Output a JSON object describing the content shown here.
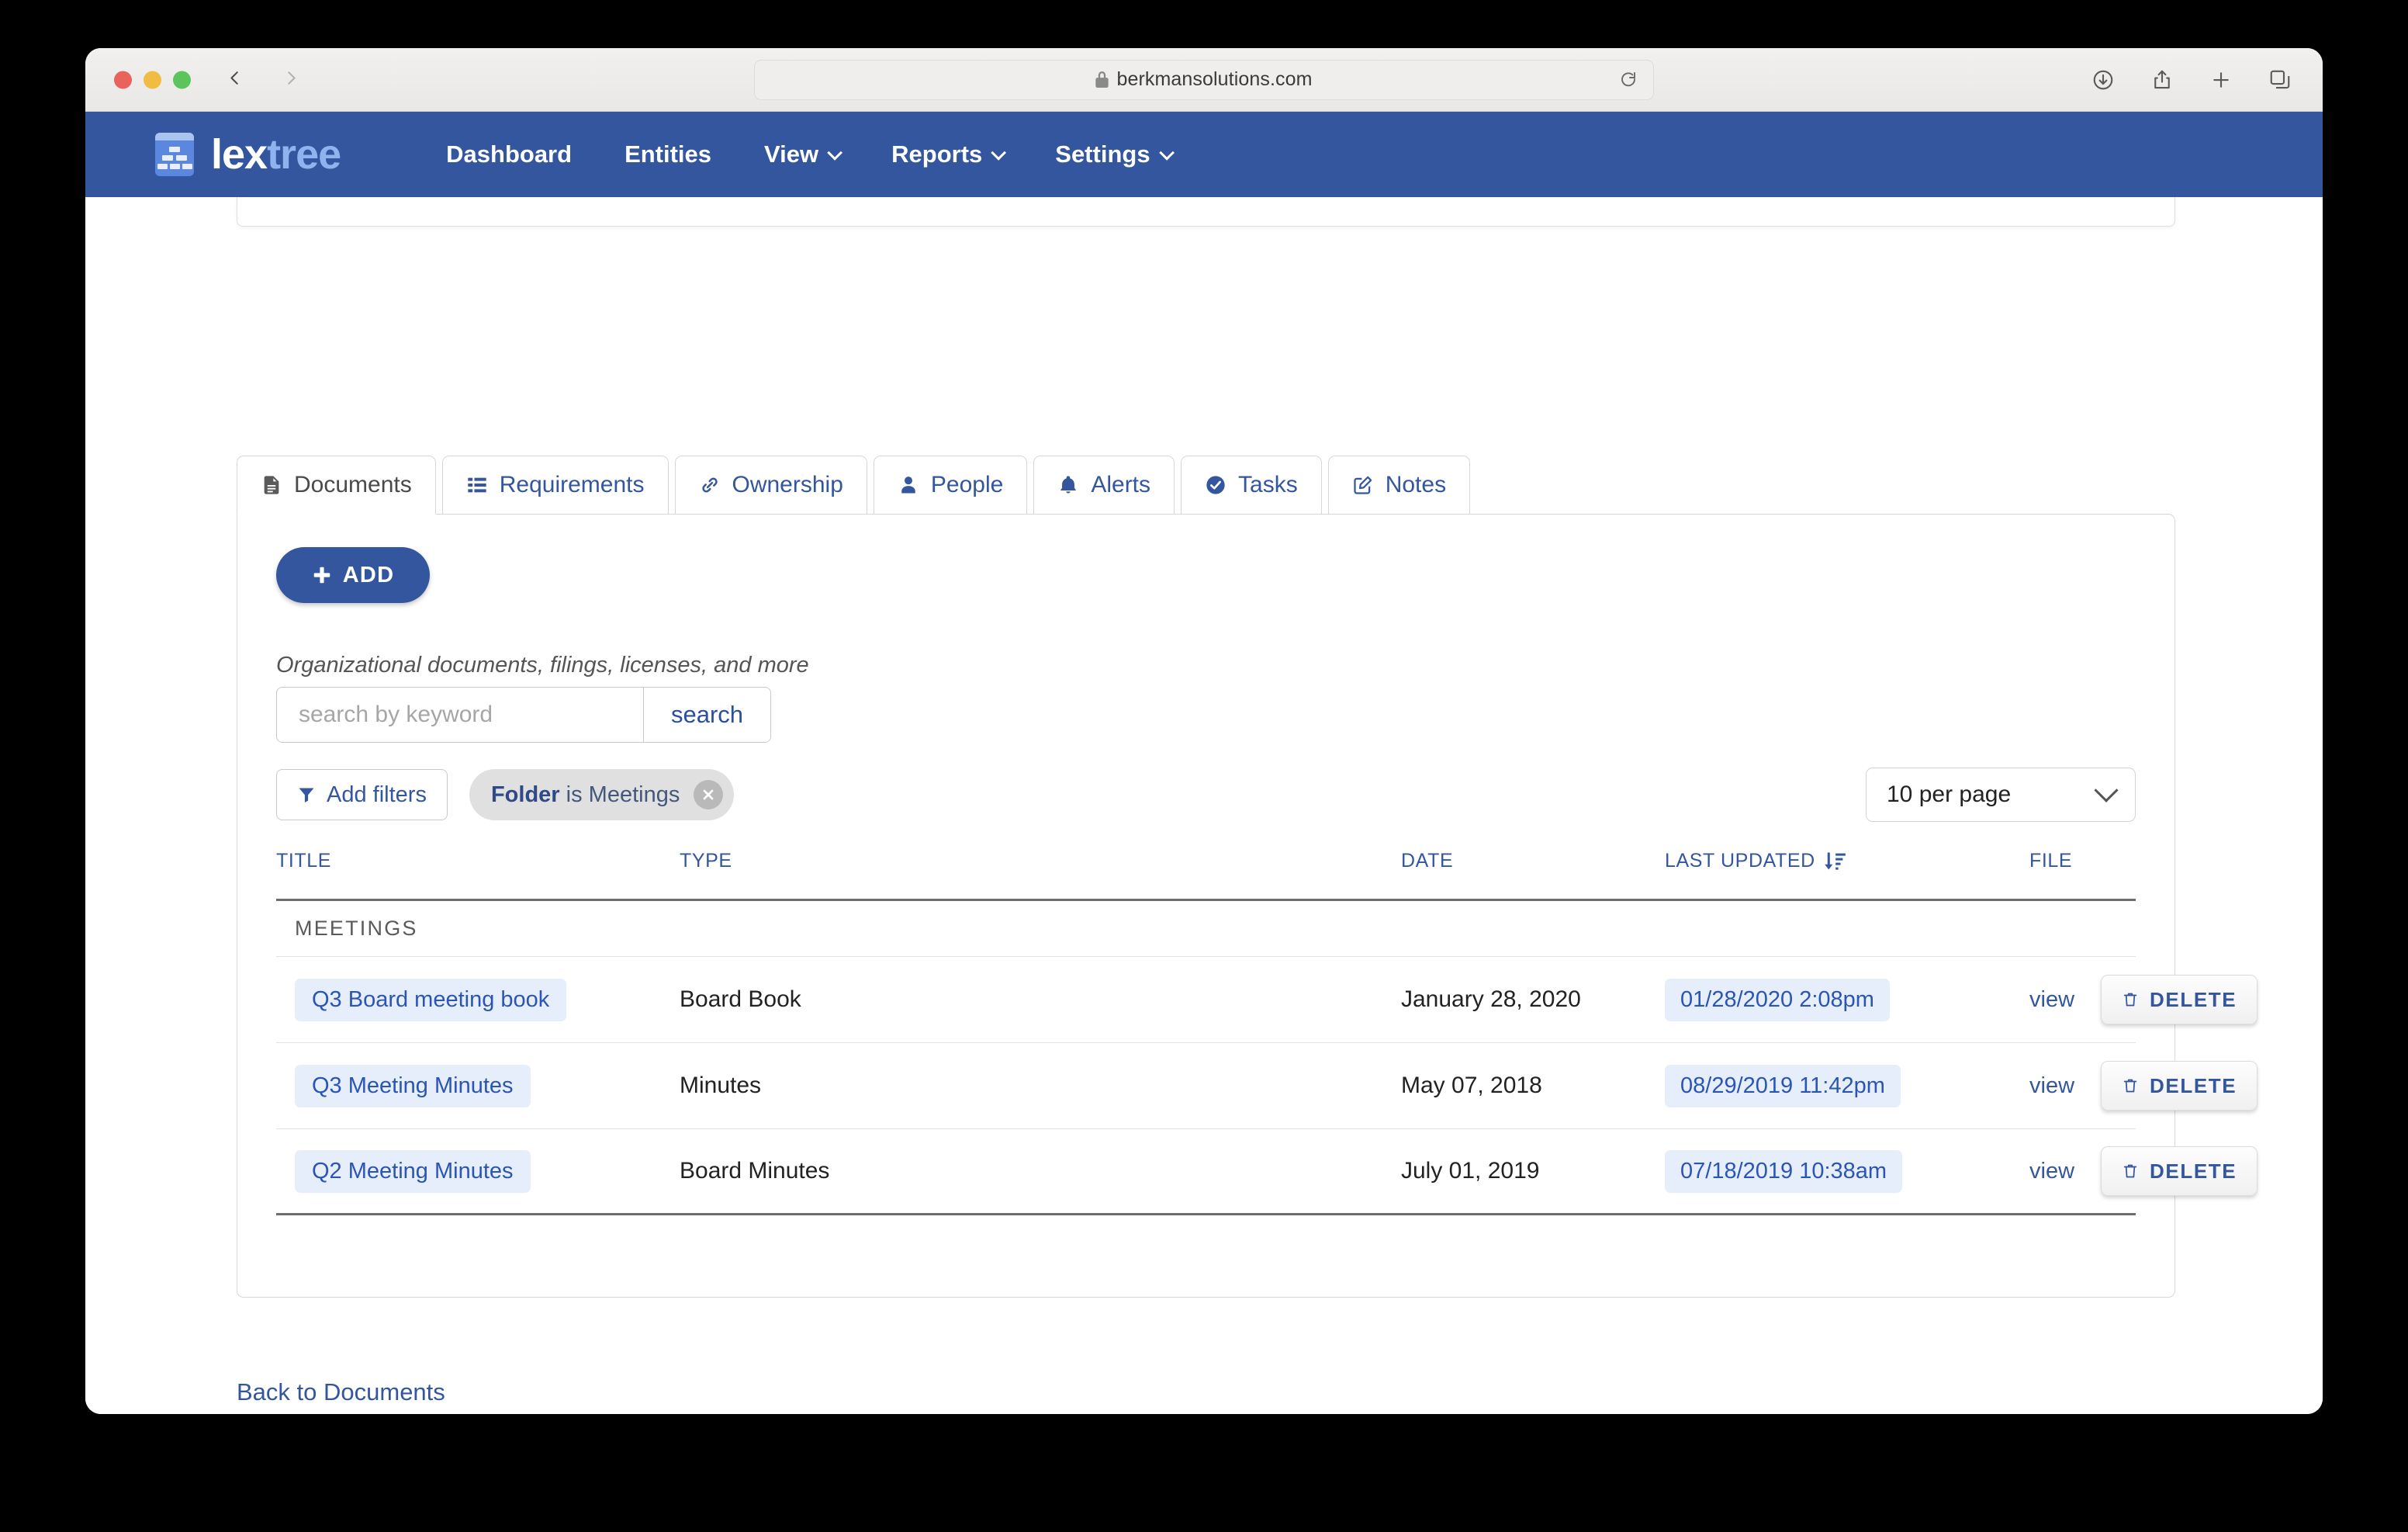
{
  "browser": {
    "url": "berkmansolutions.com",
    "icons": {
      "lock": "lock-icon",
      "reload": "reload-icon",
      "back": "back-arrow-icon",
      "forward": "forward-arrow-icon",
      "downloads": "downloads-icon",
      "share": "share-icon",
      "new_tab": "plus-icon",
      "tab_overview": "tab-overview-icon"
    }
  },
  "navbar": {
    "brand": {
      "lex": "lex",
      "tree": "tree"
    },
    "items": [
      {
        "label": "Dashboard",
        "has_caret": false
      },
      {
        "label": "Entities",
        "has_caret": false
      },
      {
        "label": "View",
        "has_caret": true
      },
      {
        "label": "Reports",
        "has_caret": true
      },
      {
        "label": "Settings",
        "has_caret": true
      }
    ],
    "accent": "#33569e"
  },
  "tabs": [
    {
      "label": "Documents",
      "icon": "document-icon",
      "active": true
    },
    {
      "label": "Requirements",
      "icon": "list-icon",
      "active": false
    },
    {
      "label": "Ownership",
      "icon": "link-icon",
      "active": false
    },
    {
      "label": "People",
      "icon": "person-icon",
      "active": false
    },
    {
      "label": "Alerts",
      "icon": "bell-icon",
      "active": false
    },
    {
      "label": "Tasks",
      "icon": "check-circle-icon",
      "active": false
    },
    {
      "label": "Notes",
      "icon": "pencil-icon",
      "active": false
    }
  ],
  "toolbar": {
    "add_label": "ADD",
    "helper_text": "Organizational documents, filings, licenses, and more",
    "search_placeholder": "search by keyword",
    "search_value": "",
    "search_button": "search",
    "add_filters_label": "Add filters",
    "filter_chip": {
      "key": "Folder",
      "operator": "is",
      "value": "Meetings"
    },
    "per_page": "10 per page"
  },
  "table": {
    "headers": {
      "title": "TITLE",
      "type": "TYPE",
      "date": "DATE",
      "last_updated": "LAST UPDATED",
      "file": "FILE"
    },
    "sort": {
      "column": "LAST UPDATED",
      "direction": "descending",
      "icon": "sort-descending-icon"
    },
    "group_label": "MEETINGS",
    "rows": [
      {
        "title": "Q3 Board meeting book",
        "type": "Board Book",
        "date": "January 28, 2020",
        "last_updated": "01/28/2020 2:08pm",
        "view": "view",
        "delete": "DELETE"
      },
      {
        "title": "Q3 Meeting Minutes",
        "type": "Minutes",
        "date": "May 07, 2018",
        "last_updated": "08/29/2019 11:42pm",
        "view": "view",
        "delete": "DELETE"
      },
      {
        "title": "Q2 Meeting Minutes",
        "type": "Board Minutes",
        "date": "July 01, 2019",
        "last_updated": "07/18/2019 10:38am",
        "view": "view",
        "delete": "DELETE"
      }
    ]
  },
  "footer": {
    "back_link": "Back to Documents"
  }
}
